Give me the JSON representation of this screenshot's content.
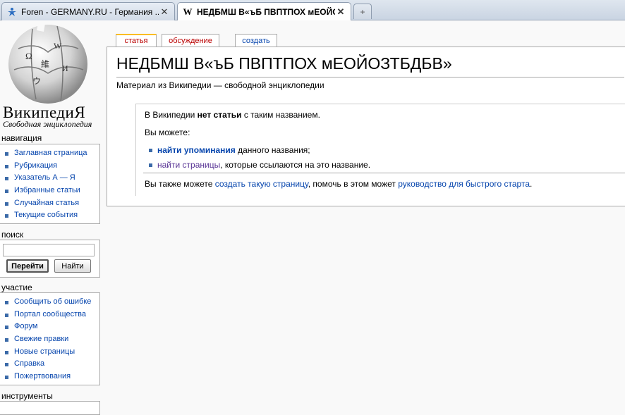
{
  "browser": {
    "tabs": [
      {
        "title": "Foren - GERMANY.RU - Германия ...",
        "icon": "person-star-icon",
        "close": "✕"
      },
      {
        "title": "НЕДБМШ В«ъБ ПВПТПОХ мЕОЙОЗТБДБВ...",
        "icon": "wikipedia-w-icon",
        "close": "✕"
      }
    ],
    "new_tab": "+"
  },
  "logo": {
    "wordmark": "ВикипедиЯ",
    "tagline": "Свободная энциклопедия"
  },
  "sidebar": {
    "navigation": {
      "title": "навигация",
      "items": [
        "Заглавная страница",
        "Рубрикация",
        "Указатель А — Я",
        "Избранные статьи",
        "Случайная статья",
        "Текущие события"
      ]
    },
    "search": {
      "title": "поиск",
      "go": "Перейти",
      "find": "Найти"
    },
    "participation": {
      "title": "участие",
      "items": [
        "Сообщить об ошибке",
        "Портал сообщества",
        "Форум",
        "Свежие правки",
        "Новые страницы",
        "Справка",
        "Пожертвования"
      ]
    },
    "tools": {
      "title": "инструменты"
    }
  },
  "content_tabs": {
    "article": "статья",
    "discussion": "обсуждение",
    "create": "создать"
  },
  "article": {
    "title": "НЕДБМШ В«ъБ ПВПТПОХ мЕОЙОЗТБДБВ»",
    "subtitle": "Материал из Википедии — свободной энциклопедии",
    "notice": {
      "line1_pre": "В Википедии ",
      "line1_bold": "нет статьи",
      "line1_post": " с таким названием.",
      "line2": "Вы можете:",
      "opt1_link": "найти упоминания",
      "opt1_rest": " данного названия;",
      "opt2_link": "найти страницы",
      "opt2_rest": ", которые ссылаются на это название.",
      "footer_pre": "Вы также можете ",
      "footer_link1": "создать такую страницу",
      "footer_mid": ", помочь в этом может ",
      "footer_link2": "руководство для быстрого старта",
      "footer_end": "."
    }
  },
  "colors": {
    "link": "#0645ad",
    "visited": "#5a3696",
    "selected_tab": "#ba0000",
    "tab_accent": "#fabd23"
  }
}
